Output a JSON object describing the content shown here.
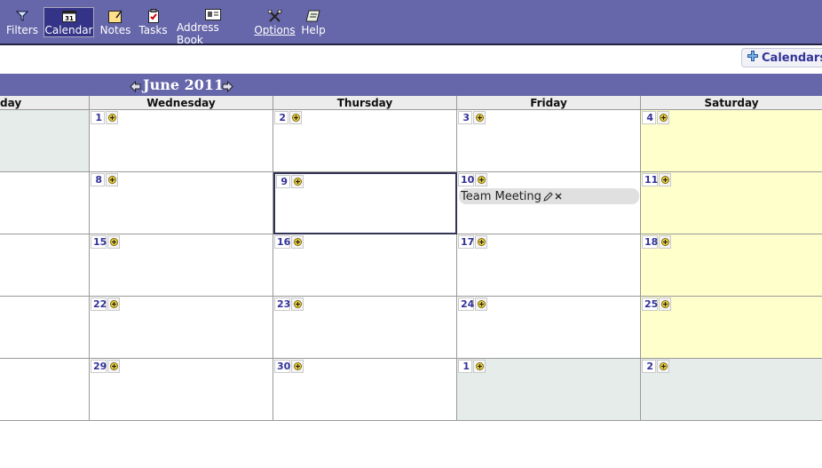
{
  "toolbar": {
    "items": [
      {
        "label": "Filters",
        "icon": "filter-icon"
      },
      {
        "label": "Calendar",
        "icon": "calendar-icon",
        "badge": "31",
        "active": true
      },
      {
        "label": "Notes",
        "icon": "notes-icon"
      },
      {
        "label": "Tasks",
        "icon": "tasks-icon"
      },
      {
        "label": "Address Book",
        "icon": "address-book-icon"
      },
      {
        "label": "Options",
        "icon": "options-icon"
      },
      {
        "label": "Help",
        "icon": "help-icon"
      }
    ]
  },
  "calendars_button": {
    "label": "Calendars",
    "icon": "plus-icon"
  },
  "month": {
    "title": "June 2011",
    "prev_icon": "arrow-left-icon",
    "next_icon": "arrow-right-icon"
  },
  "weekdays": [
    "day",
    "Wednesday",
    "Thursday",
    "Friday",
    "Saturday"
  ],
  "weeks": [
    [
      "",
      "1",
      "2",
      "3",
      "4"
    ],
    [
      "",
      "8",
      "9",
      "10",
      "11"
    ],
    [
      "",
      "15",
      "16",
      "17",
      "18"
    ],
    [
      "",
      "22",
      "23",
      "24",
      "25"
    ],
    [
      "",
      "29",
      "30",
      "1",
      "2"
    ]
  ],
  "event": {
    "title": "Team Meeting",
    "edit_icon": "pencil-icon",
    "delete_icon": "close-icon"
  },
  "colors": {
    "toolbar_bg": "#6666aa",
    "active_tab": "#333388",
    "weekend_bg": "#ffffcc",
    "other_month_bg": "#e6ecea",
    "day_number": "#333399"
  }
}
